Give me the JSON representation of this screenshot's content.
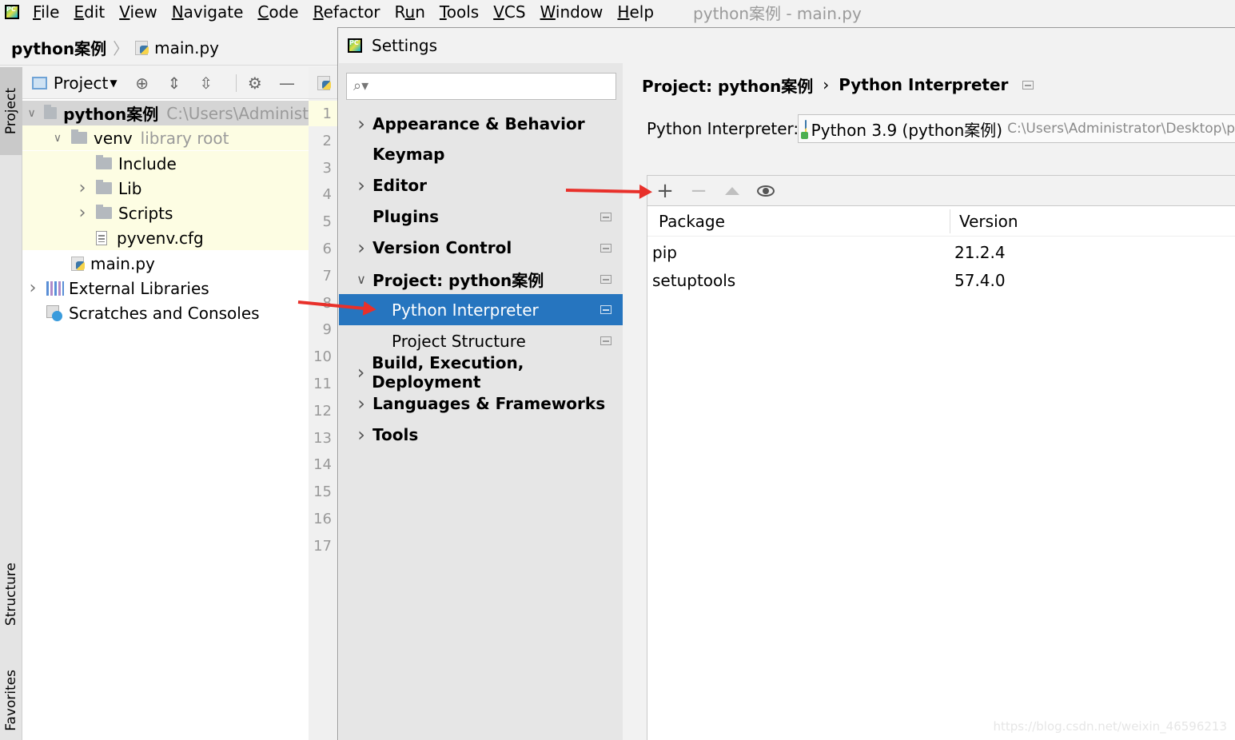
{
  "menubar": {
    "items": [
      "File",
      "Edit",
      "View",
      "Navigate",
      "Code",
      "Refactor",
      "Run",
      "Tools",
      "VCS",
      "Window",
      "Help"
    ],
    "mnemonics": [
      "F",
      "E",
      "V",
      "N",
      "C",
      "R",
      "u",
      "T",
      "V",
      "W",
      "H"
    ],
    "window_title": "python案例 - main.py"
  },
  "navbar": {
    "project": "python案例",
    "file": "main.py"
  },
  "leftstrip": {
    "project": "Project",
    "structure": "Structure",
    "favorites": "Favorites"
  },
  "project_panel": {
    "view_label": "Project",
    "tree": [
      {
        "label": "python案例",
        "hint": "C:\\Users\\Administ",
        "kind": "folder",
        "level": 0,
        "expanded": true
      },
      {
        "label": "venv",
        "hint": "library root",
        "kind": "folder",
        "level": 1,
        "expanded": true
      },
      {
        "label": "Include",
        "kind": "folder",
        "level": 2
      },
      {
        "label": "Lib",
        "kind": "folder",
        "level": 2,
        "expanded": false
      },
      {
        "label": "Scripts",
        "kind": "folder",
        "level": 2,
        "expanded": false
      },
      {
        "label": "pyvenv.cfg",
        "kind": "file",
        "level": 2
      },
      {
        "label": "main.py",
        "kind": "pyfile",
        "level": 1
      },
      {
        "label": "External Libraries",
        "kind": "libs",
        "level": 0,
        "expanded": false
      },
      {
        "label": "Scratches and Consoles",
        "kind": "scratch",
        "level": 0
      }
    ]
  },
  "gutter": {
    "lines": [
      "1",
      "2",
      "3",
      "4",
      "5",
      "6",
      "7",
      "8",
      "9",
      "10",
      "11",
      "12",
      "13",
      "14",
      "15",
      "16",
      "17"
    ]
  },
  "settings": {
    "title": "Settings",
    "search_placeholder": "",
    "nav": [
      {
        "label": "Appearance & Behavior",
        "chevron": "right",
        "bold": true
      },
      {
        "label": "Keymap",
        "chevron": "none",
        "bold": true
      },
      {
        "label": "Editor",
        "chevron": "right",
        "bold": true
      },
      {
        "label": "Plugins",
        "chevron": "none",
        "bold": true,
        "badge": true
      },
      {
        "label": "Version Control",
        "chevron": "right",
        "bold": true,
        "badge": true
      },
      {
        "label": "Project: python案例",
        "chevron": "down",
        "bold": true,
        "badge": true
      },
      {
        "label": "Python Interpreter",
        "chevron": "none",
        "sub": true,
        "selected": true,
        "badge": true
      },
      {
        "label": "Project Structure",
        "chevron": "none",
        "sub": true,
        "badge": true
      },
      {
        "label": "Build, Execution, Deployment",
        "chevron": "right",
        "bold": true
      },
      {
        "label": "Languages & Frameworks",
        "chevron": "right",
        "bold": true
      },
      {
        "label": "Tools",
        "chevron": "right",
        "bold": true
      }
    ],
    "breadcrumb": {
      "parent": "Project: python案例",
      "current": "Python Interpreter"
    },
    "interpreter_label": "Python Interpreter:",
    "interpreter_value": "Python 3.9 (python案例)",
    "interpreter_path": "C:\\Users\\Administrator\\Desktop\\p",
    "table": {
      "headers": [
        "Package",
        "Version"
      ],
      "rows": [
        {
          "package": "pip",
          "version": "21.2.4"
        },
        {
          "package": "setuptools",
          "version": "57.4.0"
        }
      ]
    }
  },
  "watermark": "https://blog.csdn.net/weixin_46596213",
  "colors": {
    "selection": "#2675bf",
    "annotation_arrow": "#e8302a",
    "library_root_bg": "#fdfde3"
  }
}
